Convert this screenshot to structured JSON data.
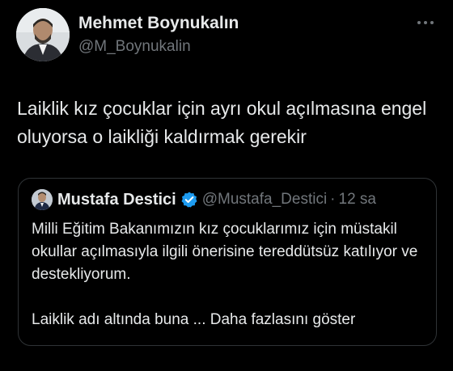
{
  "author": {
    "display_name": "Mehmet Boynukalın",
    "handle": "@M_Boynukalin",
    "avatar_icon": "user-avatar"
  },
  "more_icon": "more-horizontal-icon",
  "tweet": {
    "text": "Laiklik kız çocuklar için ayrı okul açılmasına engel oluyorsa o laikliği kaldırmak gerekir"
  },
  "quote": {
    "display_name": "Mustafa Destici",
    "verified_icon": "verified-badge-icon",
    "handle": "@Mustafa_Destici",
    "separator": "·",
    "time": "12 sa",
    "paragraph1": "Milli Eğitim Bakanımızın kız çocuklarımız için müstakil okullar açılmasıyla ilgili önerisine tereddütsüz katılıyor ve destekliyorum.",
    "paragraph2_prefix": "Laiklik adı altında buna ...",
    "show_more": "Daha fazlasını göster"
  },
  "colors": {
    "background": "#000000",
    "primary_text": "#e7e9ea",
    "secondary_text": "#71767b",
    "border": "#2f3336",
    "verified": "#1d9bf0"
  }
}
